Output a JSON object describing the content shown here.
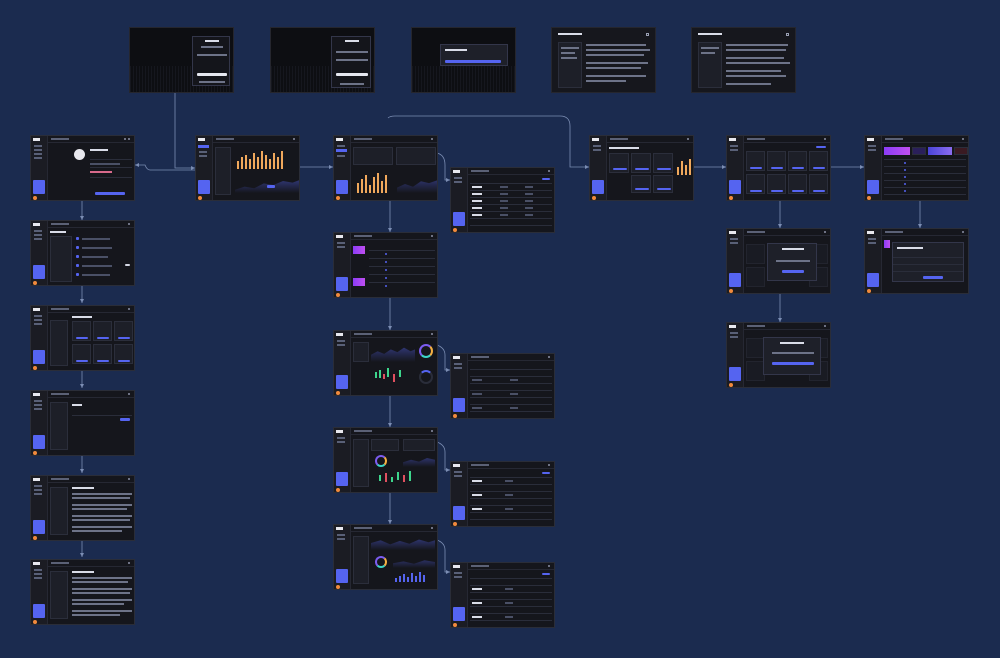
{
  "canvas": {
    "background": "#1b2b4f",
    "accent": "#5564f0",
    "screen_bg": "#15161c",
    "connector_color": "#7b8db3"
  },
  "screens": [
    "auth-login",
    "auth-register",
    "auth-reset",
    "auth-terms",
    "auth-privacy",
    "profile",
    "dashboard",
    "analytics-main",
    "analytics-table",
    "notifications",
    "nfts-list",
    "faq",
    "terms",
    "privacy",
    "market",
    "market-detail",
    "market-detail-table",
    "trading",
    "trading-table",
    "portfolio",
    "portfolio-table",
    "welcome",
    "collections",
    "collections-modal-1",
    "collections-modal-2",
    "nft-market",
    "nft-detail"
  ]
}
